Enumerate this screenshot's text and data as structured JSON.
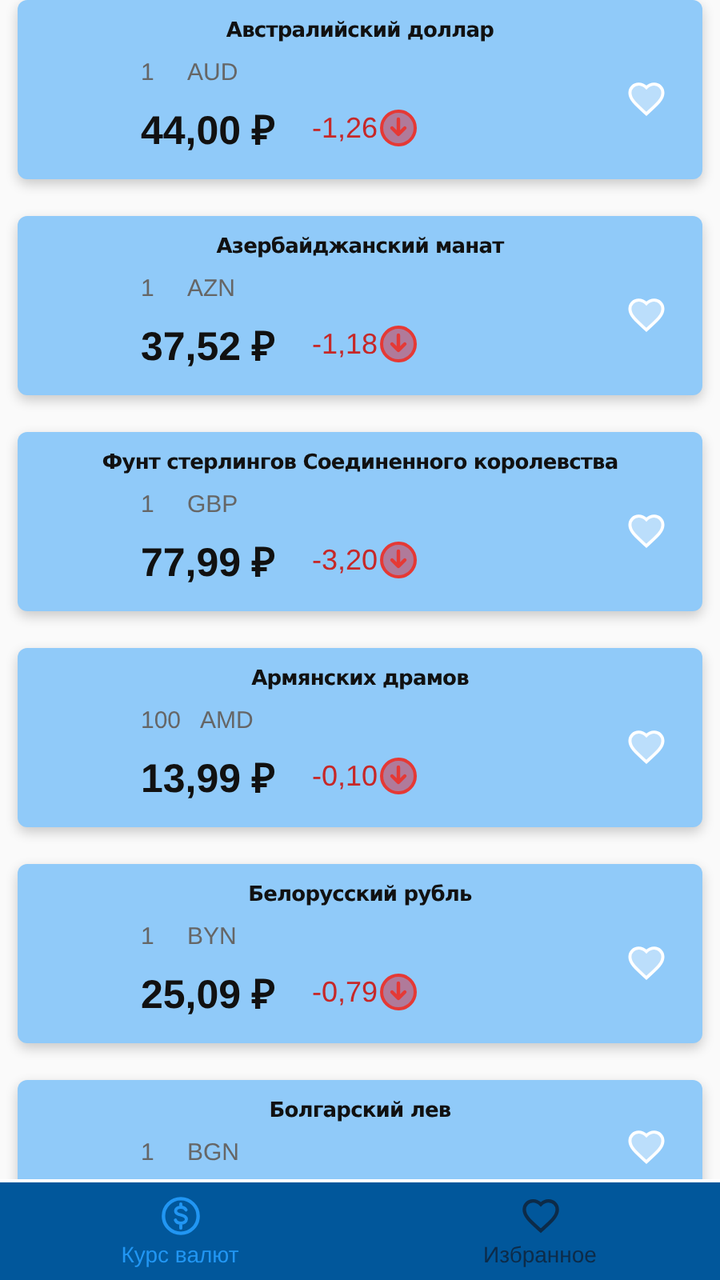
{
  "currencies": [
    {
      "name": "Австралийский доллар",
      "nominal": "1",
      "code": "AUD",
      "rate": "44,00 ₽",
      "change": "-1,26",
      "rising": false,
      "favorite": false
    },
    {
      "name": "Азербайджанский манат",
      "nominal": "1",
      "code": "AZN",
      "rate": "37,52 ₽",
      "change": "-1,18",
      "rising": false,
      "favorite": false
    },
    {
      "name": "Фунт стерлингов Соединенного королевства",
      "nominal": "1",
      "code": "GBP",
      "rate": "77,99 ₽",
      "change": "-3,20",
      "rising": false,
      "favorite": false
    },
    {
      "name": "Армянских драмов",
      "nominal": "100",
      "code": "AMD",
      "rate": "13,99 ₽",
      "change": "-0,10",
      "rising": false,
      "favorite": false
    },
    {
      "name": "Белорусский рубль",
      "nominal": "1",
      "code": "BYN",
      "rate": "25,09 ₽",
      "change": "-0,79",
      "rising": false,
      "favorite": false
    },
    {
      "name": "Болгарский лев",
      "nominal": "1",
      "code": "BGN",
      "favorite": false
    }
  ],
  "nav": [
    {
      "label": "Курс валют",
      "kind": "rates",
      "selected": true
    },
    {
      "label": "Избранное",
      "kind": "favorites",
      "selected": false
    }
  ]
}
